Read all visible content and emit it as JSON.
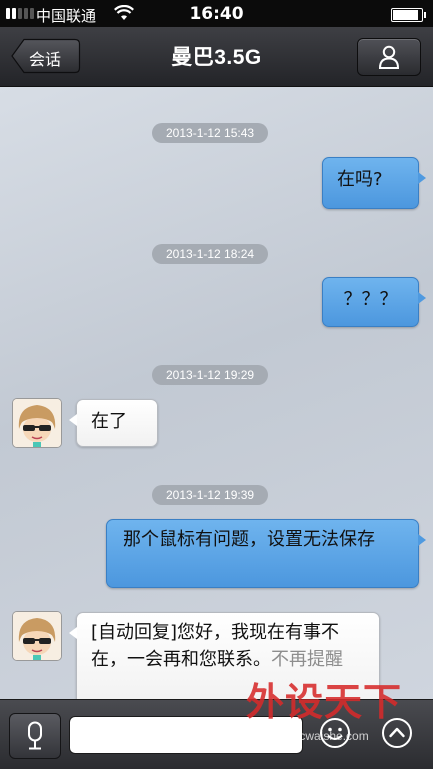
{
  "status_bar": {
    "carrier": "中国联通",
    "time": "16:40"
  },
  "nav": {
    "back_label": "会话",
    "title": "曼巴3.5G"
  },
  "messages": [
    {
      "type": "time",
      "text": "2013-1-12 15:43"
    },
    {
      "type": "out",
      "text": "在吗?"
    },
    {
      "type": "time",
      "text": "2013-1-12 18:24"
    },
    {
      "type": "out",
      "text": "？？？"
    },
    {
      "type": "time",
      "text": "2013-1-12 19:29"
    },
    {
      "type": "in",
      "text": "在了"
    },
    {
      "type": "time",
      "text": "2013-1-12 19:39"
    },
    {
      "type": "out",
      "text": "那个鼠标有问题，设置无法保存"
    },
    {
      "type": "in",
      "text": "[自动回复]您好，我现在有事不在，一会再和您联系。",
      "muted": "不再提醒"
    }
  ],
  "input": {
    "value": "",
    "placeholder": ""
  },
  "watermark": {
    "text": "外设天下",
    "url": "www.pcwaishe.com"
  },
  "colors": {
    "outgoing_bubble": "#5aa5e8",
    "incoming_bubble": "#ffffff",
    "nav_bar": "#2f3034",
    "timestamp_pill": "#a5abb3"
  },
  "icons": [
    "back-arrow-icon",
    "person-icon",
    "microphone-icon",
    "smiley-icon",
    "chevron-up-icon",
    "wifi-icon",
    "battery-icon"
  ]
}
